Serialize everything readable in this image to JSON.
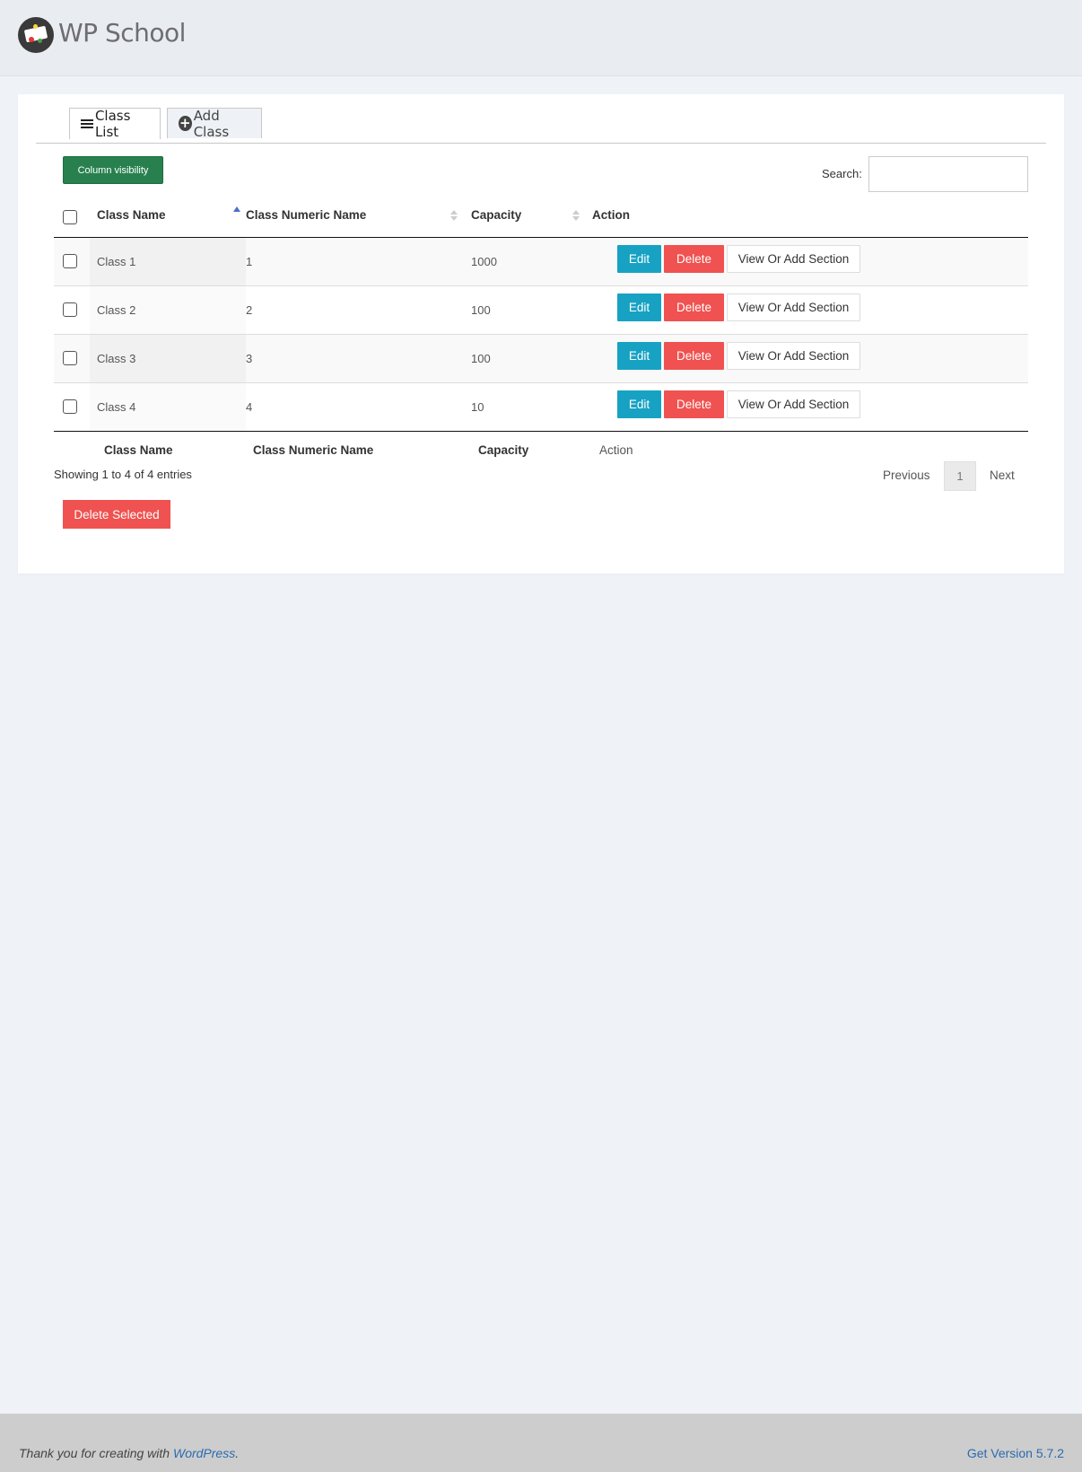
{
  "header": {
    "brand": "WP School",
    "logo": "school-logo"
  },
  "tabs": [
    {
      "label": "Class List",
      "icon": "list-icon",
      "active": true
    },
    {
      "label": "Add Class",
      "icon": "plus-circle-icon",
      "active": false
    }
  ],
  "toolbar": {
    "column_visibility_label": "Column visibility",
    "search_label": "Search:",
    "search_value": ""
  },
  "table": {
    "headers": [
      "Class Name",
      "Class Numeric Name",
      "Capacity",
      "Action"
    ],
    "sort": {
      "column": "Class Name",
      "direction": "asc"
    },
    "rows": [
      {
        "name": "Class 1",
        "numeric": "1",
        "capacity": "1000"
      },
      {
        "name": "Class 2",
        "numeric": "2",
        "capacity": "100"
      },
      {
        "name": "Class 3",
        "numeric": "3",
        "capacity": "100"
      },
      {
        "name": "Class 4",
        "numeric": "4",
        "capacity": "10"
      }
    ],
    "actions": {
      "edit": "Edit",
      "delete": "Delete",
      "view": "View Or Add Section"
    },
    "footers": [
      "Class Name",
      "Class Numeric Name",
      "Capacity",
      "Action"
    ]
  },
  "pagination": {
    "info": "Showing 1 to 4 of 4 entries",
    "previous": "Previous",
    "current": "1",
    "next": "Next"
  },
  "bulk": {
    "delete_selected": "Delete Selected"
  },
  "footer": {
    "thanks_prefix": "Thank you for creating with ",
    "thanks_link": "WordPress",
    "thanks_suffix": ".",
    "version": "Get Version 5.7.2"
  },
  "colors": {
    "edit": "#17a2c3",
    "delete": "#ef5250",
    "column_visibility": "#28804f",
    "link": "#2a6bb0"
  }
}
